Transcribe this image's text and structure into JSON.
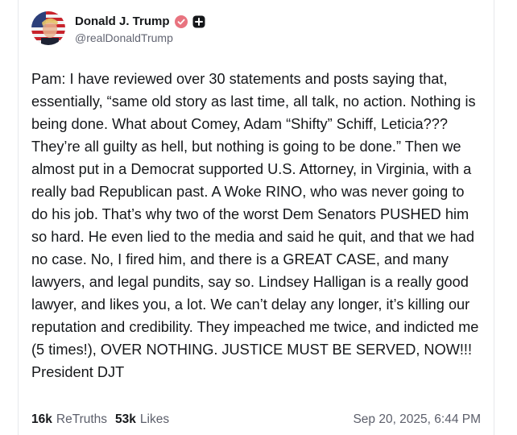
{
  "author": {
    "display_name": "Donald J. Trump",
    "handle": "@realDonaldTrump",
    "verified_badge_icon": "verified-check-icon",
    "secondary_badge_icon": "plus-square-icon",
    "badge_color": "#e8737f"
  },
  "post": {
    "text": "Pam: I have reviewed over 30 statements and posts saying that, essentially, “same old story as last time, all talk, no action. Nothing is being done. What about Comey, Adam “Shifty” Schiff, Leticia??? They’re all guilty as hell, but nothing is going to be done.” Then we almost put in a Democrat supported U.S. Attorney, in Virginia, with a really bad Republican past. A Woke RINO, who was never going to do his job. That’s why two of the worst Dem Senators PUSHED him so hard. He even lied to the media and said he quit, and that we had no case. No, I fired him, and there is a GREAT CASE, and many lawyers, and legal pundits, say so. Lindsey Halligan is a really good lawyer, and likes you, a lot. We can’t delay any longer, it’s killing our reputation and credibility. They impeached me twice, and indicted me (5 times!), OVER NOTHING. JUSTICE MUST BE SERVED, NOW!!! President DJT"
  },
  "stats": {
    "retruths_count": "16k",
    "retruths_label": "ReTruths",
    "likes_count": "53k",
    "likes_label": "Likes"
  },
  "timestamp": "Sep 20, 2025, 6:44 PM"
}
